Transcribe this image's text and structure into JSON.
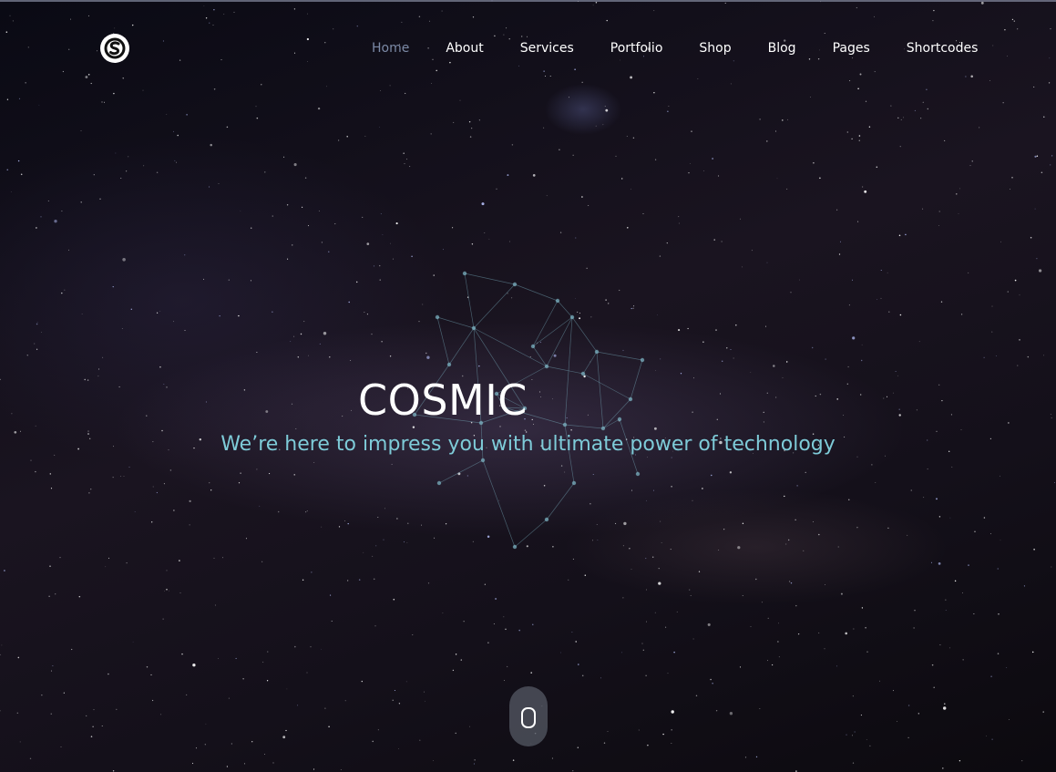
{
  "brand": {
    "logo_icon": "circled-s-logo-icon"
  },
  "nav": {
    "items": [
      {
        "label": "Home",
        "active": true
      },
      {
        "label": "About",
        "active": false
      },
      {
        "label": "Services",
        "active": false
      },
      {
        "label": "Portfolio",
        "active": false
      },
      {
        "label": "Shop",
        "active": false
      },
      {
        "label": "Blog",
        "active": false
      },
      {
        "label": "Pages",
        "active": false
      },
      {
        "label": "Shortcodes",
        "active": false
      }
    ],
    "active_color": "#7c8aa6",
    "text_color": "#ffffff"
  },
  "hero": {
    "title": "COSMIC",
    "tagline": "We’re here to impress you with ultimate power of technology",
    "tagline_color": "#7ecbd8",
    "background": "starry-night-sky"
  },
  "scroll_indicator": {
    "icon": "mouse-scroll-icon"
  }
}
